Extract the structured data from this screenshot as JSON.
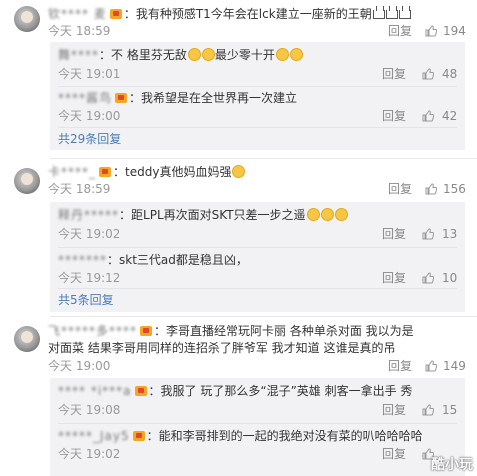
{
  "comments": [
    {
      "username": "钦**** 麦",
      "text": "我有种预感T1今年会在lck建立一座新的王朝",
      "time": "今天 18:59",
      "reply": "回复",
      "likes": "194",
      "replies": [
        {
          "username": "舞****",
          "text": "不 格里芬无敌",
          "text2": "最少零十开",
          "time": "今天 19:01",
          "reply": "回复",
          "likes": "48"
        },
        {
          "username": "****酱鸟",
          "text": "我希望是在全世界再一次建立",
          "time": "今天 19:00",
          "reply": "回复",
          "likes": "42"
        }
      ],
      "more": "共29条回复"
    },
    {
      "username": "卡****_",
      "text": "teddy真他妈血妈强",
      "time": "今天 18:59",
      "reply": "回复",
      "likes": "156",
      "replies": [
        {
          "username": "释丹*****",
          "text": "距LPL再次面对SKT只差一步之遥",
          "time": "今天 19:02",
          "reply": "回复",
          "likes": "13"
        },
        {
          "username": "*******",
          "text": "skt三代ad都是稳且凶，",
          "time": "今天 19:12",
          "reply": "回复",
          "likes": "10"
        }
      ],
      "more": "共5条回复"
    },
    {
      "username": "飞*****多****",
      "text": "李哥直播经常玩阿卡丽 各种单杀对面 我以为是",
      "text_line2": "对面菜 结果李哥用同样的连招杀了胖爷军 我才知道 这谁是真的吊",
      "time": "今天 19:00",
      "reply": "回复",
      "likes": "149",
      "replies": [
        {
          "username": "**** *i***a",
          "text": "我服了 玩了那么多“混子”英雄 刺客一拿出手 秀",
          "time": "今天 19:08",
          "reply": "回复",
          "likes": "15"
        },
        {
          "username": "*****_Jay5",
          "text": "能和李哥排到的一起的我绝对没有菜的叭哈哈哈哈",
          "time": "今天 19:02",
          "reply": "回复",
          "likes": ""
        }
      ]
    }
  ],
  "icons": {
    "thumb": "thumbs-up-icon",
    "badge": "vip-badge-icon",
    "emoji": "smile-emoji-icon",
    "crown": "crown-icon"
  },
  "watermark": "酷小玩",
  "colors": {
    "link": "#4a7cba",
    "subBackground": "#f2f2f5",
    "meta": "#999999"
  }
}
